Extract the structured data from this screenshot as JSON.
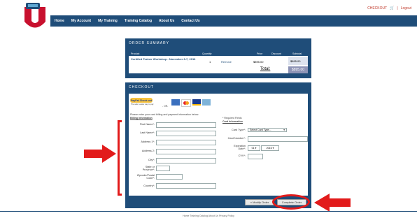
{
  "header": {
    "top_links": {
      "checkout": "CHECKOUT",
      "logout": "Logout"
    },
    "nav": [
      "Home",
      "My Account",
      "My Training",
      "Training Catalog",
      "About Us",
      "Contact Us"
    ]
  },
  "order_summary": {
    "title": "ORDER SUMMARY",
    "columns": [
      "Product",
      "Quantity",
      "Price",
      "Discount",
      "Subtotal"
    ],
    "item": {
      "product": "Certified Trainer Workshop - November 6-7, 2016",
      "quantity": "1",
      "remove": "Remove",
      "price": "$895.00",
      "subtotal": "$895.00"
    },
    "total_label": "Total:",
    "total_value": "$895.00"
  },
  "checkout": {
    "title": "CHECKOUT",
    "paypal_label": "PayPal Check out",
    "paypal_note": "The safer, easier way to pay",
    "or": "- OR-",
    "instructions": "Please enter your card billing and payment information below.",
    "required_note": "* Required Fields",
    "billing_header": "Billing Information",
    "card_header": "Card Information",
    "billing_fields": [
      "First Name*:",
      "Last Name*:",
      "Address 1*:",
      "Address 2:",
      "City*:",
      "State or Province*:",
      "Zipcode/Postal Code*:",
      "Country*:"
    ],
    "card_type_label": "Card Type*:",
    "card_type_value": "Select Card Type...",
    "card_number_label": "Card Number*:",
    "expiration_label": "Expiration Date*:",
    "exp_month": "01",
    "exp_year": "2016",
    "cvv_label": "CVV*:",
    "modify_button": "« Modify Order",
    "complete_button": "Complete Order"
  },
  "footer": {
    "links": "Home   Training Catalog   About Us   Privacy Policy"
  },
  "colors": {
    "brand": "#1f4d79",
    "annotation_red": "#e21b1b"
  }
}
